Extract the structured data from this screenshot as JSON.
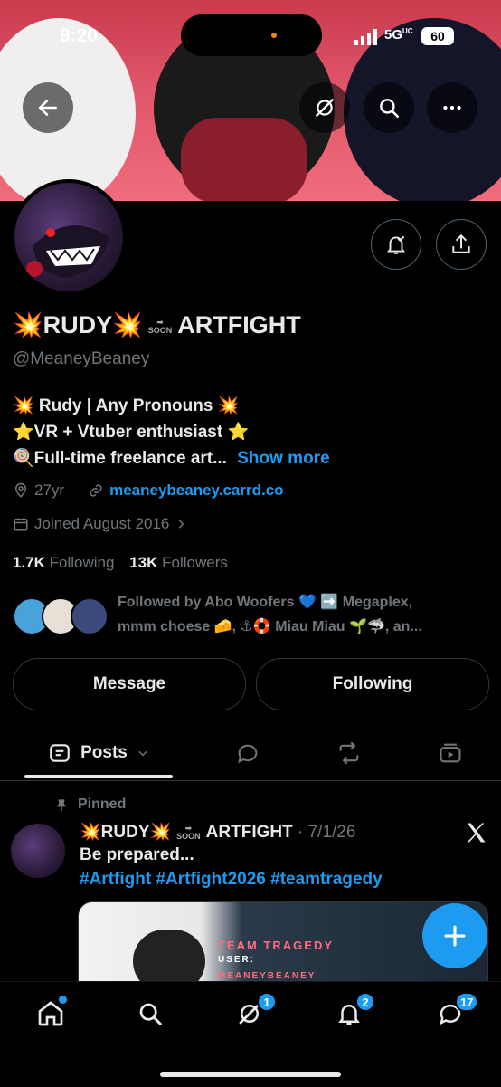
{
  "status_bar": {
    "time": "9:20",
    "network": "5G",
    "network_suffix": "UC",
    "battery": "60"
  },
  "profile": {
    "name_part1": "💥RUDY💥",
    "soon_label": "SOON",
    "name_part2": "ARTFIGHT",
    "handle": "@MeaneyBeaney",
    "bio_line1": "💥 Rudy | Any Pronouns 💥",
    "bio_line2": "⭐VR + Vtuber enthusiast ⭐",
    "bio_line3": "🍭Full-time freelance art...",
    "show_more": "Show more",
    "age": "27yr",
    "website": "meaneybeaney.carrd.co",
    "joined": "Joined August 2016",
    "following_count": "1.7K",
    "following_label": "Following",
    "followers_count": "13K",
    "followers_label": "Followers",
    "followed_by_line1": "Followed by Abo Woofers 💙 ➡️ Megaplex,",
    "followed_by_line2": "mmm choese 🧀, ⚓🛟 Miau Miau 🌱🦈, an..."
  },
  "actions": {
    "message": "Message",
    "following": "Following"
  },
  "tabs": {
    "posts": "Posts"
  },
  "pinned_post": {
    "pinned_label": "Pinned",
    "author_part1": "💥RUDY💥",
    "soon_label": "SOON",
    "author_part2": "ARTFIGHT",
    "date": "· 7/1/26",
    "text": "Be prepared...",
    "hashtags": "#Artfight #Artfight2026 #teamtragedy",
    "media_title": "TEAM TRAGEDY",
    "media_user_label": "USER:",
    "media_user": "MEANEYBEANEY"
  },
  "nav_badges": {
    "grok": "1",
    "notifications": "2",
    "messages": "17"
  },
  "colors": {
    "accent": "#1d9bf0",
    "banner": "#e0566a",
    "background": "#000000"
  }
}
